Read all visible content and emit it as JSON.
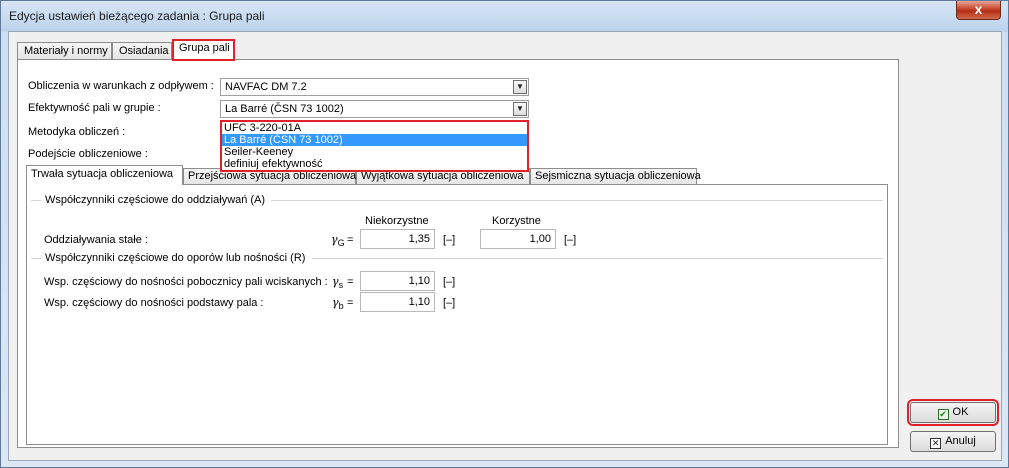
{
  "window": {
    "title": "Edycja ustawień bieżącego zadania : Grupa pali",
    "close_label": "x"
  },
  "tabs": [
    {
      "label": "Materiały i normy"
    },
    {
      "label": "Osiadania"
    },
    {
      "label": "Grupa pali"
    }
  ],
  "form": {
    "drained_label": "Obliczenia w warunkach z odpływem :",
    "drained_value": "NAVFAC DM 7.2",
    "efficiency_label": "Efektywność pali w grupie :",
    "efficiency_value": "La Barré (ČSN 73 1002)",
    "method_label": "Metodyka obliczeń :",
    "approach_label": "Podejście obliczeniowe :"
  },
  "dropdown": {
    "options": [
      "UFC 3-220-01A",
      "La Barré (ČSN 73 1002)",
      "Seiler-Keeney",
      "definiuj efektywność"
    ],
    "selected_index": 1
  },
  "inner_tabs": [
    {
      "label": "Trwała sytuacja obliczeniowa"
    },
    {
      "label": "Przejściowa sytuacja obliczeniowa"
    },
    {
      "label": "Wyjątkowa sytuacja obliczeniowa"
    },
    {
      "label": "Sejsmiczna sytuacja obliczeniowa"
    }
  ],
  "panel": {
    "group_a_title": "Współczynniki częściowe do oddziaływań (A)",
    "col_unfavourable": "Niekorzystne",
    "col_favourable": "Korzystne",
    "permanent_label": "Oddziaływania stałe :",
    "gamma_g": "γ",
    "gamma_g_sub": "G",
    "equals": "=",
    "permanent_unfav": "1,35",
    "permanent_fav": "1,00",
    "unit": "[–]",
    "group_r_title": "Współczynniki częściowe do oporów lub nośności (R)",
    "shaft_label": "Wsp. częściowy do nośności pobocznicy pali wciskanych :",
    "gamma_s": "γ",
    "gamma_s_sub": "s",
    "shaft_value": "1,10",
    "base_label": "Wsp. częściowy do nośności podstawy pala :",
    "gamma_b": "γ",
    "gamma_b_sub": "b",
    "base_value": "1,10"
  },
  "buttons": {
    "ok": "OK",
    "cancel": "Anuluj"
  }
}
